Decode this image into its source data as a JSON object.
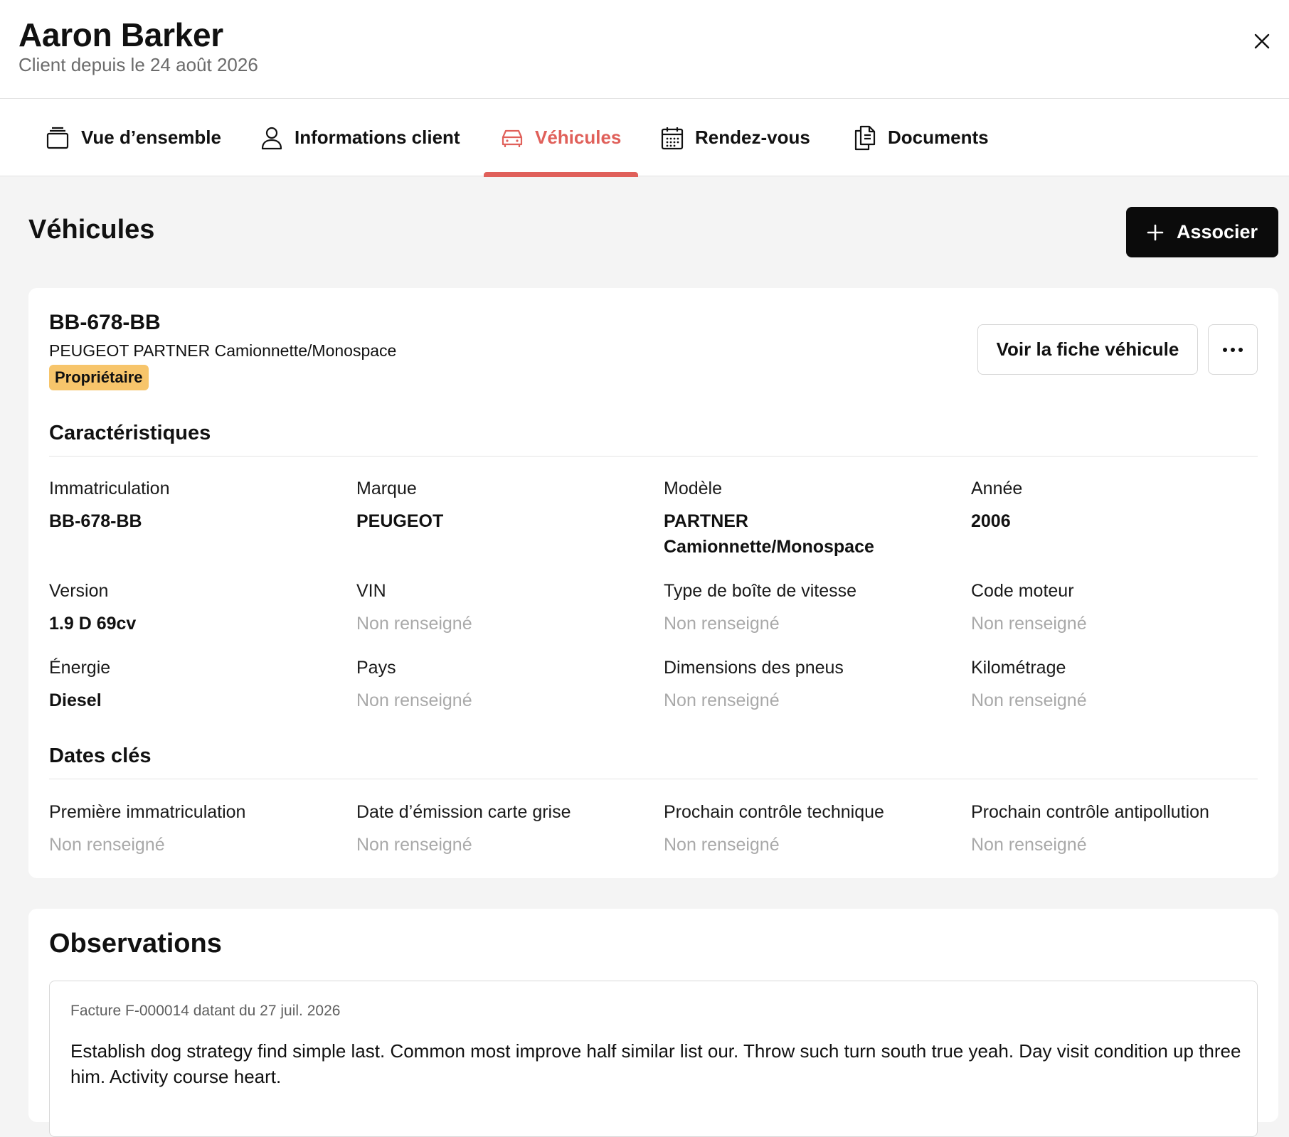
{
  "header": {
    "client_name": "Aaron Barker",
    "client_since": "Client depuis le 24 août 2026"
  },
  "tabs": [
    {
      "label": "Vue d’ensemble",
      "icon": "stack-icon"
    },
    {
      "label": "Informations client",
      "icon": "user-icon"
    },
    {
      "label": "Véhicules",
      "icon": "car-icon",
      "active": true
    },
    {
      "label": "Rendez-vous",
      "icon": "calendar-icon"
    },
    {
      "label": "Documents",
      "icon": "documents-icon"
    }
  ],
  "colors": {
    "accent": "#e0605a",
    "badge": "#f7c56b",
    "primary_button": "#0b0b0b"
  },
  "page": {
    "title": "Véhicules",
    "associate_label": "Associer"
  },
  "vehicle": {
    "plate": "BB-678-BB",
    "model_line": "PEUGEOT PARTNER Camionnette/Monospace",
    "badge": "Propriétaire",
    "view_label": "Voir la fiche véhicule",
    "characteristics_title": "Caractéristiques",
    "fields": [
      {
        "label": "Immatriculation",
        "value": "BB-678-BB",
        "empty": false
      },
      {
        "label": "Marque",
        "value": "PEUGEOT",
        "empty": false
      },
      {
        "label": "Modèle",
        "value": "PARTNER Camionnette/Monospace",
        "empty": false
      },
      {
        "label": "Année",
        "value": "2006",
        "empty": false
      },
      {
        "label": "Version",
        "value": "1.9 D 69cv",
        "empty": false
      },
      {
        "label": "VIN",
        "value": "Non renseigné",
        "empty": true
      },
      {
        "label": "Type de boîte de vitesse",
        "value": "Non renseigné",
        "empty": true
      },
      {
        "label": "Code moteur",
        "value": "Non renseigné",
        "empty": true
      },
      {
        "label": "Énergie",
        "value": "Diesel",
        "empty": false
      },
      {
        "label": "Pays",
        "value": "Non renseigné",
        "empty": true
      },
      {
        "label": "Dimensions des pneus",
        "value": "Non renseigné",
        "empty": true
      },
      {
        "label": "Kilométrage",
        "value": "Non renseigné",
        "empty": true
      }
    ],
    "dates_title": "Dates clés",
    "dates": [
      {
        "label": "Première immatriculation",
        "value": "Non renseigné",
        "empty": true
      },
      {
        "label": "Date d’émission carte grise",
        "value": "Non renseigné",
        "empty": true
      },
      {
        "label": "Prochain contrôle technique",
        "value": "Non renseigné",
        "empty": true
      },
      {
        "label": "Prochain contrôle antipollution",
        "value": "Non renseigné",
        "empty": true
      }
    ]
  },
  "observations": {
    "title": "Observations",
    "meta": "Facture F-000014 datant du 27 juil. 2026",
    "text": "Establish dog strategy find simple last. Common most improve half similar list our. Throw such turn south true yeah. Day visit condition up three him. Activity course heart."
  }
}
